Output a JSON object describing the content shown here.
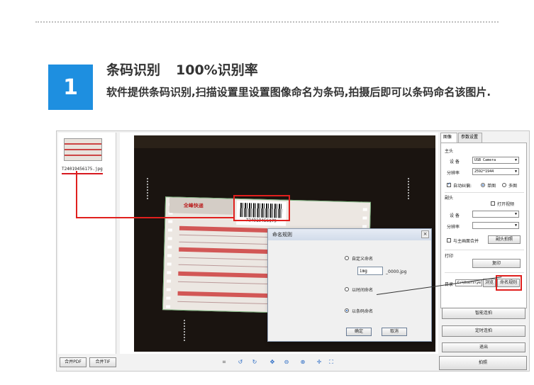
{
  "step": {
    "number": "1",
    "title": "条码识别",
    "title_rate": "100%识别率",
    "description": "软件提供条码识别,扫描设置里设置图像命名为条码,拍摄后即可以条码命名该图片."
  },
  "thumbnail": {
    "filename": "T24019456175.jpg"
  },
  "document": {
    "barcode_number": "724019456175",
    "brand": "全峰快递"
  },
  "dialog": {
    "title": "命名规则",
    "close": "×",
    "option_custom": "自定义命名",
    "custom_prefix_value": "img",
    "custom_suffix": "_0000.jpg",
    "option_time": "以时间命名",
    "option_barcode": "以条码命名",
    "ok_label": "确定",
    "cancel_label": "取消"
  },
  "right_panel": {
    "tabs": [
      "图像",
      "参数设置"
    ],
    "main_head": {
      "section": "主头",
      "device_label": "设 备",
      "device_value": "USB Camera",
      "resolution_label": "分辨率",
      "resolution_value": "2592*1944",
      "auto_crop_label": "自动纠偏:",
      "single_label": "单图",
      "multi_label": "多图"
    },
    "sub_head": {
      "section": "副头",
      "open_video_label": "打开视频",
      "device_label": "设 备",
      "resolution_label": "分辨率",
      "merge_label": "与主画面合并",
      "sub_capture_button": "副头拍照"
    },
    "print": {
      "section": "打印",
      "print_button": "复印"
    },
    "directory": {
      "label": "目录",
      "path": "C:\\Users\\ye",
      "browse_button": "浏览",
      "naming_rule_button": "命名规则"
    },
    "buttons": {
      "smart_capture": "智能连拍",
      "timed_capture": "定时连拍",
      "exit": "退出",
      "capture": "拍照"
    }
  },
  "bottom_bar": {
    "merge_pdf": "合并PDF",
    "merge_tif": "合并TIF"
  },
  "colors": {
    "accent_blue": "#1e8fe0",
    "highlight_red": "#e0201e"
  }
}
